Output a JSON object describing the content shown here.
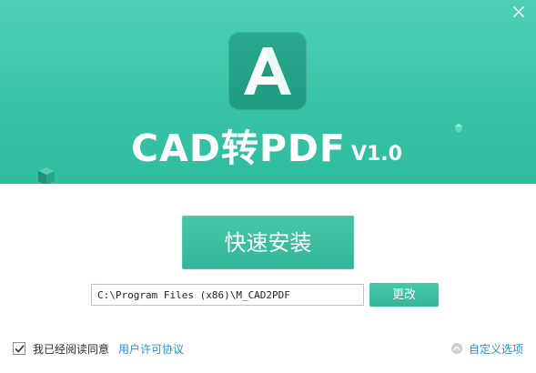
{
  "window": {
    "close_icon": "close-icon"
  },
  "header": {
    "logo_icon": "a-logo-icon",
    "title": "CAD转PDF",
    "version": "V1.0"
  },
  "actions": {
    "install_label": "快速安装",
    "change_label": "更改"
  },
  "install_path": {
    "value": "C:\\Program Files (x86)\\M_CAD2PDF"
  },
  "footer": {
    "agree_checked": true,
    "agree_text": "我已经阅读同意",
    "license_link": "用户许可协议",
    "custom_options": "自定义选项",
    "custom_options_icon": "chevron-up-circle-icon"
  },
  "colors": {
    "accent": "#39c1a4",
    "accent_dark": "#1f9b80",
    "link": "#2f8fd3"
  }
}
